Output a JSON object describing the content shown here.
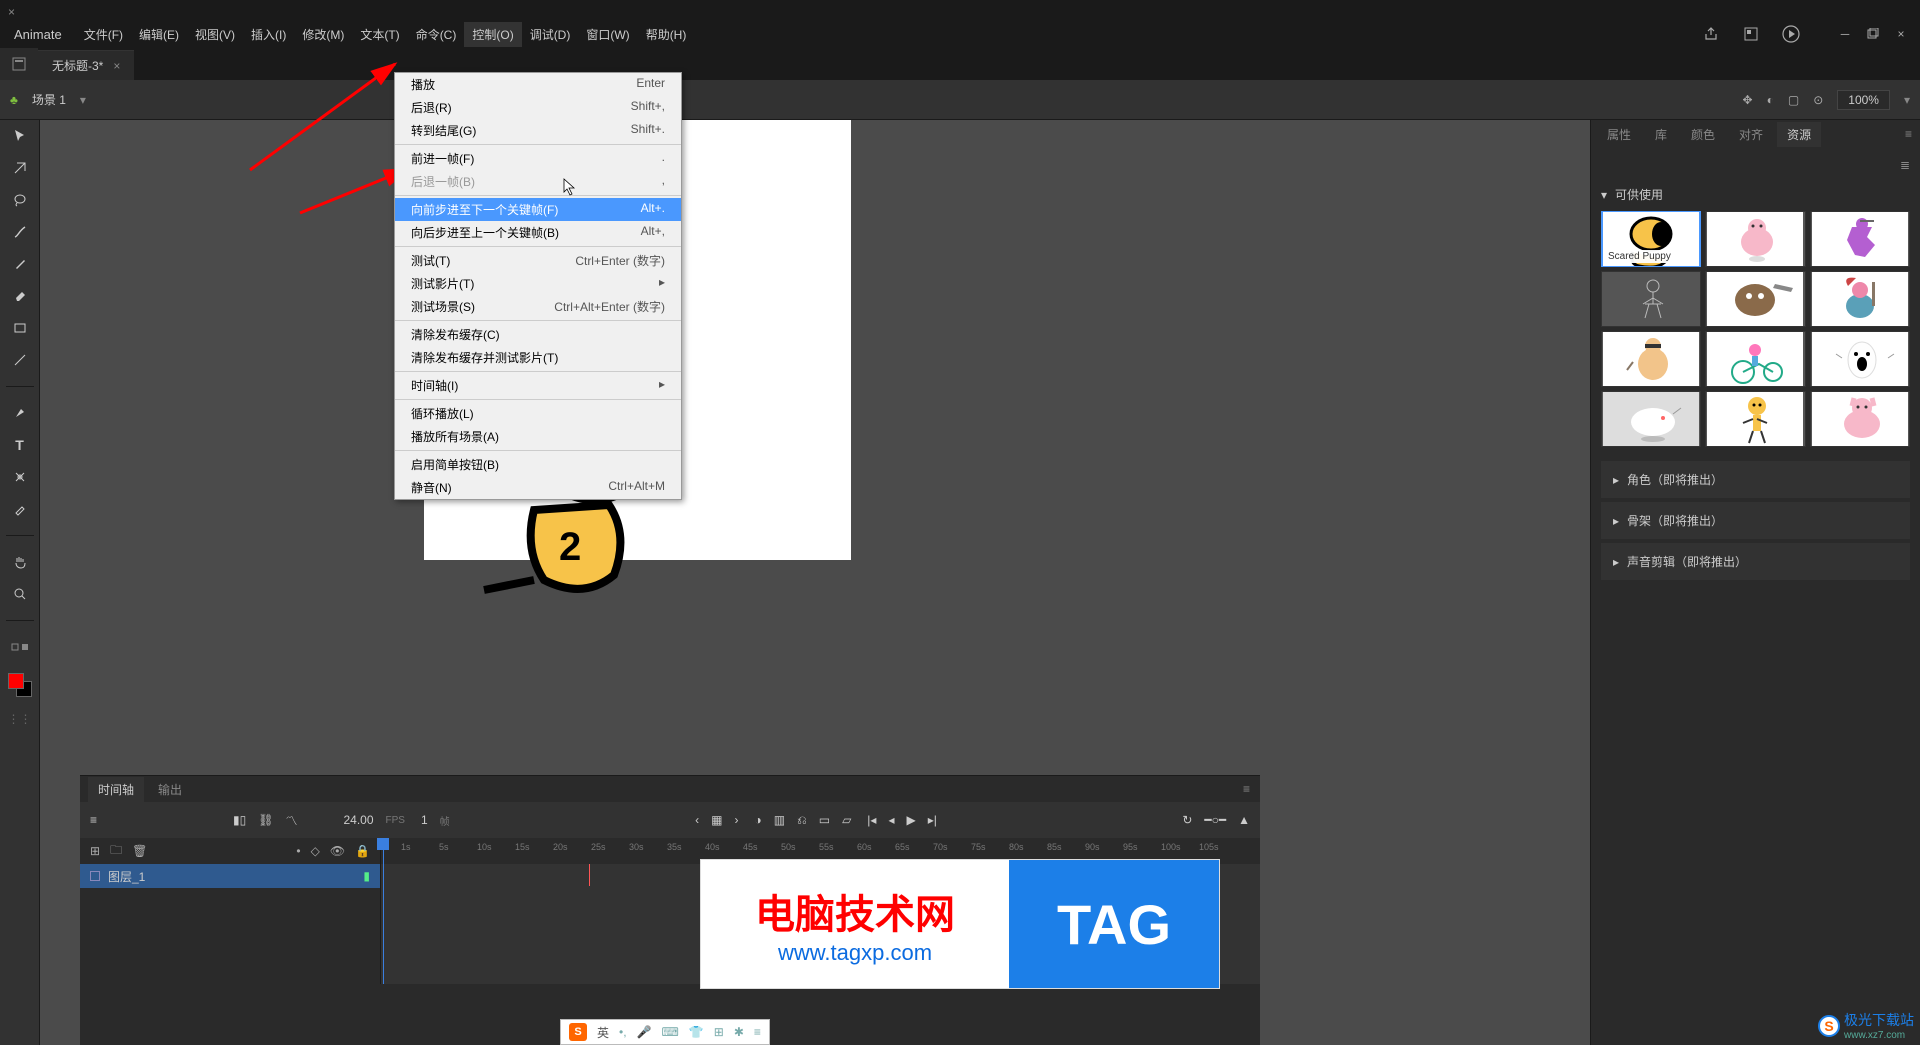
{
  "app": {
    "name": "Animate"
  },
  "menu": {
    "items": [
      "文件(F)",
      "编辑(E)",
      "视图(V)",
      "插入(I)",
      "修改(M)",
      "文本(T)",
      "命令(C)",
      "控制(O)",
      "调试(D)",
      "窗口(W)",
      "帮助(H)"
    ],
    "active_index": 7
  },
  "document": {
    "tab_title": "无标题-3*"
  },
  "scene": {
    "name": "场景 1",
    "zoom": "100%"
  },
  "context_menu": {
    "groups": [
      [
        {
          "label": "播放",
          "shortcut": "Enter"
        },
        {
          "label": "后退(R)",
          "shortcut": "Shift+,"
        },
        {
          "label": "转到结尾(G)",
          "shortcut": "Shift+."
        }
      ],
      [
        {
          "label": "前进一帧(F)",
          "shortcut": "."
        },
        {
          "label": "后退一帧(B)",
          "shortcut": ",",
          "disabled": true
        }
      ],
      [
        {
          "label": "向前步进至下一个关键帧(F)",
          "shortcut": "Alt+.",
          "hover": true
        },
        {
          "label": "向后步进至上一个关键帧(B)",
          "shortcut": "Alt+,"
        }
      ],
      [
        {
          "label": "测试(T)",
          "shortcut": "Ctrl+Enter",
          "note": "(数字)"
        },
        {
          "label": "测试影片(T)",
          "shortcut": "",
          "sub": true
        },
        {
          "label": "测试场景(S)",
          "shortcut": "Ctrl+Alt+Enter",
          "note": "(数字)"
        }
      ],
      [
        {
          "label": "清除发布缓存(C)",
          "shortcut": ""
        },
        {
          "label": "清除发布缓存并测试影片(T)",
          "shortcut": ""
        }
      ],
      [
        {
          "label": "时间轴(I)",
          "shortcut": "",
          "sub": true
        }
      ],
      [
        {
          "label": "循环播放(L)",
          "shortcut": ""
        },
        {
          "label": "播放所有场景(A)",
          "shortcut": ""
        }
      ],
      [
        {
          "label": "启用简单按钮(B)",
          "shortcut": ""
        },
        {
          "label": "静音(N)",
          "shortcut": "Ctrl+Alt+M"
        }
      ]
    ]
  },
  "right_panel": {
    "tabs": [
      "属性",
      "库",
      "颜色",
      "对齐",
      "资源"
    ],
    "active_tab": 4,
    "section_available": "可供使用",
    "selected_asset_label": "Scared Puppy",
    "collapsed_sections": [
      "角色（即将推出）",
      "骨架（即将推出）",
      "声音剪辑（即将推出）"
    ]
  },
  "timeline": {
    "tabs": [
      "时间轴",
      "输出"
    ],
    "active_tab": 0,
    "fps": "24.00",
    "fps_unit": "FPS",
    "frame_current": "1",
    "frame_unit": "帧",
    "layer_name": "图层_1",
    "ruler_ticks": [
      "1s",
      "5s",
      "10s",
      "15s",
      "20s",
      "25s",
      "30s",
      "35s",
      "40s",
      "45s",
      "50s",
      "55s",
      "60s",
      "65s",
      "70s",
      "75s",
      "80s",
      "85s",
      "90s",
      "95s",
      "100s",
      "105s"
    ]
  },
  "watermark": {
    "title": "电脑技术网",
    "url": "www.tagxp.com",
    "tag": "TAG"
  },
  "corner_watermark": {
    "logo": "S",
    "text1": "极光下载站",
    "text2": "www.xz7.com"
  },
  "ime": {
    "lang": "英"
  }
}
